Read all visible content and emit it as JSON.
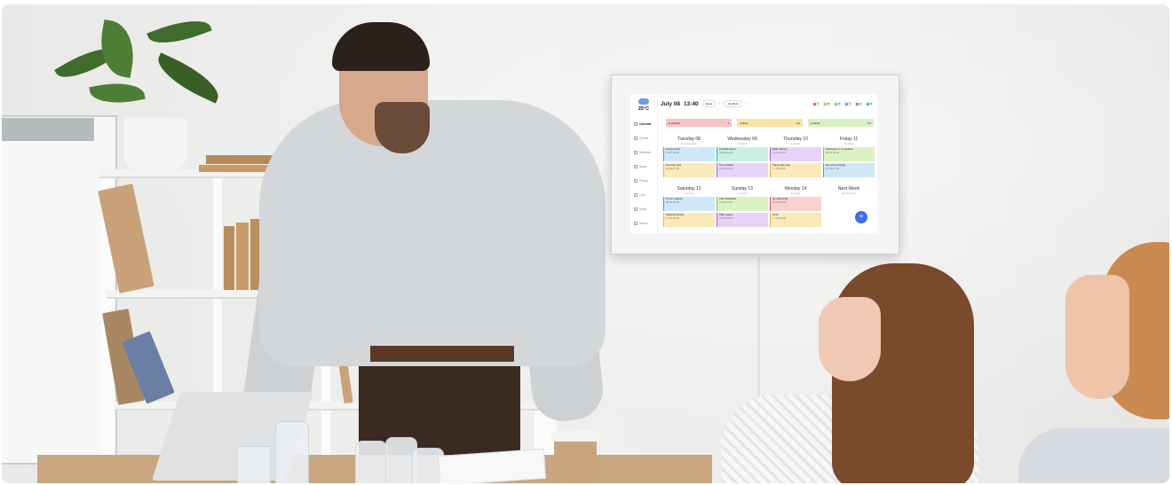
{
  "calendar": {
    "temperature": "25°C",
    "date": "July 08",
    "time": "13:40",
    "view": "Week",
    "range": "Jul 08-14",
    "sidebar": [
      "Calendar",
      "Chores",
      "Rewards",
      "Meals",
      "Photos",
      "Lists",
      "Sleep",
      "Menus"
    ],
    "lanes": [
      {
        "name": "Victoria",
        "count": "1",
        "color": "#f7c3c3"
      },
      {
        "name": "Mary",
        "count": "1/4",
        "color": "#fbe3a6"
      },
      {
        "name": "David",
        "count": "1/4",
        "color": "#d8f0c2"
      }
    ],
    "members": [
      {
        "label": "V",
        "color": "#e84b4b"
      },
      {
        "label": "M",
        "color": "#f2a83a"
      },
      {
        "label": "D",
        "color": "#8bc34a"
      },
      {
        "label": "S",
        "color": "#3aa0e8"
      },
      {
        "label": "U",
        "color": "#a05de0"
      },
      {
        "label": "B",
        "color": "#23b3a0"
      }
    ],
    "days_row1": [
      {
        "name": "Tuesday",
        "num": "08",
        "sub": "4 events today",
        "events": [
          {
            "title": "Going out art",
            "time": "11:00-12:00",
            "color": "#cfe8f7",
            "bar": "#3aa0e8"
          },
          {
            "title": "Feed the pets",
            "time": "16:00-17:00",
            "color": "#fbe9b8",
            "bar": "#f2a83a"
          }
        ]
      },
      {
        "name": "Wednesday",
        "num": "09",
        "sub": "4 events",
        "events": [
          {
            "title": "Football lesson",
            "time": "09:00-12:00",
            "color": "#c9f0e2",
            "bar": "#23b3a0"
          },
          {
            "title": "Get a haircut",
            "time": "15:00-16:00",
            "color": "#e6d4f7",
            "bar": "#a05de0"
          }
        ]
      },
      {
        "name": "Thursday",
        "num": "10",
        "sub": "4 events",
        "events": [
          {
            "title": "Math tutoring",
            "time": "11:00-12:00",
            "color": "#e6d4f7",
            "bar": "#a05de0"
          },
          {
            "title": "Puppy play date",
            "time": "17:00-18:00",
            "color": "#fbe9b8",
            "bar": "#f2a83a"
          }
        ]
      },
      {
        "name": "Friday",
        "num": "11",
        "sub": "4 events",
        "events": [
          {
            "title": "Participate in a marathon",
            "time": "09:00-10:00",
            "color": "#dcf2c4",
            "bar": "#8bc34a"
          },
          {
            "title": "Go to the hospital",
            "time": "16:00-17:00",
            "color": "#cfe8f7",
            "bar": "#3aa0e8"
          }
        ]
      }
    ],
    "days_row2": [
      {
        "name": "Saturday",
        "num": "12",
        "sub": "4 events",
        "events": [
          {
            "title": "Put on makeup",
            "time": "08:00-09:00",
            "color": "#cfe8f7",
            "bar": "#3aa0e8"
          },
          {
            "title": "Watering flowers",
            "time": "17:00-18:00",
            "color": "#fbe9b8",
            "bar": "#f2a83a"
          }
        ]
      },
      {
        "name": "Sunday",
        "num": "13",
        "sub": "4 events",
        "events": [
          {
            "title": "Play basketball",
            "time": "10:00-11:00",
            "color": "#dcf2c4",
            "bar": "#8bc34a"
          },
          {
            "title": "Play a game",
            "time": "18:00-19:00",
            "color": "#e6d4f7",
            "bar": "#a05de0"
          }
        ]
      },
      {
        "name": "Monday",
        "num": "14",
        "sub": "4 events",
        "events": [
          {
            "title": "Go swimming",
            "time": "09:00-10:00",
            "color": "#f7d0d0",
            "bar": "#e84b4b"
          },
          {
            "title": "Cook",
            "time": "17:00-18:00",
            "color": "#fbe9b8",
            "bar": "#f2a83a"
          }
        ]
      },
      {
        "name": "Next Week",
        "num": "",
        "sub": "Jul 15-Jul 21",
        "events": []
      }
    ],
    "add_button": "+"
  }
}
